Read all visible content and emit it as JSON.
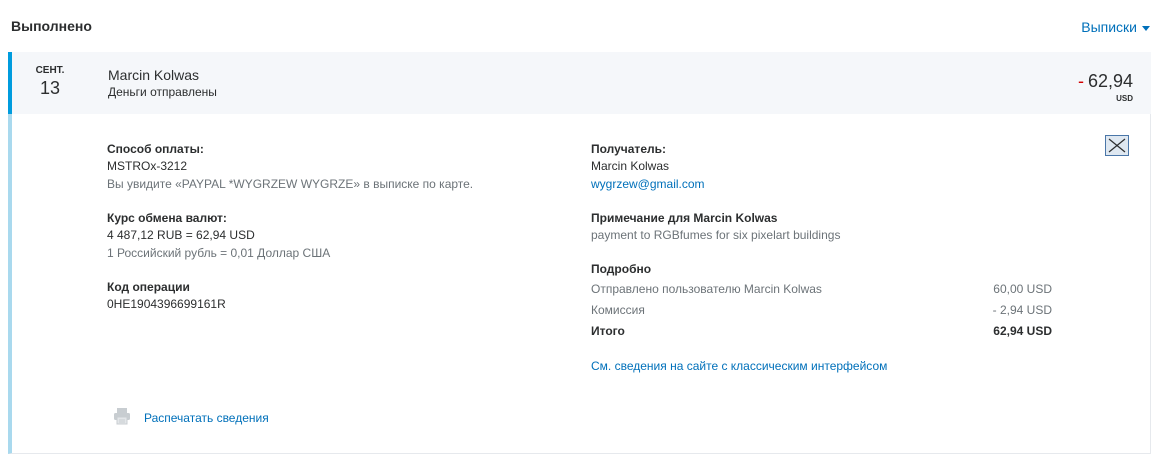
{
  "header": {
    "title": "Выполнено",
    "statements_label": "Выписки"
  },
  "transaction": {
    "month": "СЕНТ.",
    "day": "13",
    "name": "Marcin Kolwas",
    "status": "Деньги отправлены",
    "amount_sign": "-",
    "amount": "62,94",
    "currency": "USD"
  },
  "details": {
    "payment_method_label": "Способ оплаты:",
    "payment_method_value": "MSTROx-3212",
    "payment_method_note": "Вы увидите «PAYPAL *WYGRZEW WYGRZE» в выписке по карте.",
    "exchange_label": "Курс обмена валют:",
    "exchange_value": "4 487,12 RUB = 62,94 USD",
    "exchange_note": "1 Российский рубль = 0,01 Доллар США",
    "tx_id_label": "Код операции",
    "tx_id_value": "0HE1904396699161R",
    "recipient_label": "Получатель:",
    "recipient_name": "Marcin Kolwas",
    "recipient_email": "wygrzew@gmail.com",
    "note_label": "Примечание для Marcin Kolwas",
    "note_value": "payment to RGBfumes for six pixelart buildings",
    "breakdown_label": "Подробно",
    "breakdown": [
      {
        "label": "Отправлено пользователю Marcin Kolwas",
        "value": "60,00 USD"
      },
      {
        "label": "Комиссия",
        "value": "- 2,94 USD"
      },
      {
        "label": "Итого",
        "value": "62,94 USD"
      }
    ],
    "classic_link": "См. сведения на сайте с классическим интерфейсом",
    "print_link": "Распечатать сведения"
  },
  "icons": {
    "close": "close-icon",
    "print": "printer-icon",
    "dropdown": "caret-down-icon"
  },
  "colors": {
    "link": "#0070ba",
    "accent_bar": "#009cde",
    "accent_bar_light": "#a9d9ee",
    "negative": "#d20000"
  }
}
